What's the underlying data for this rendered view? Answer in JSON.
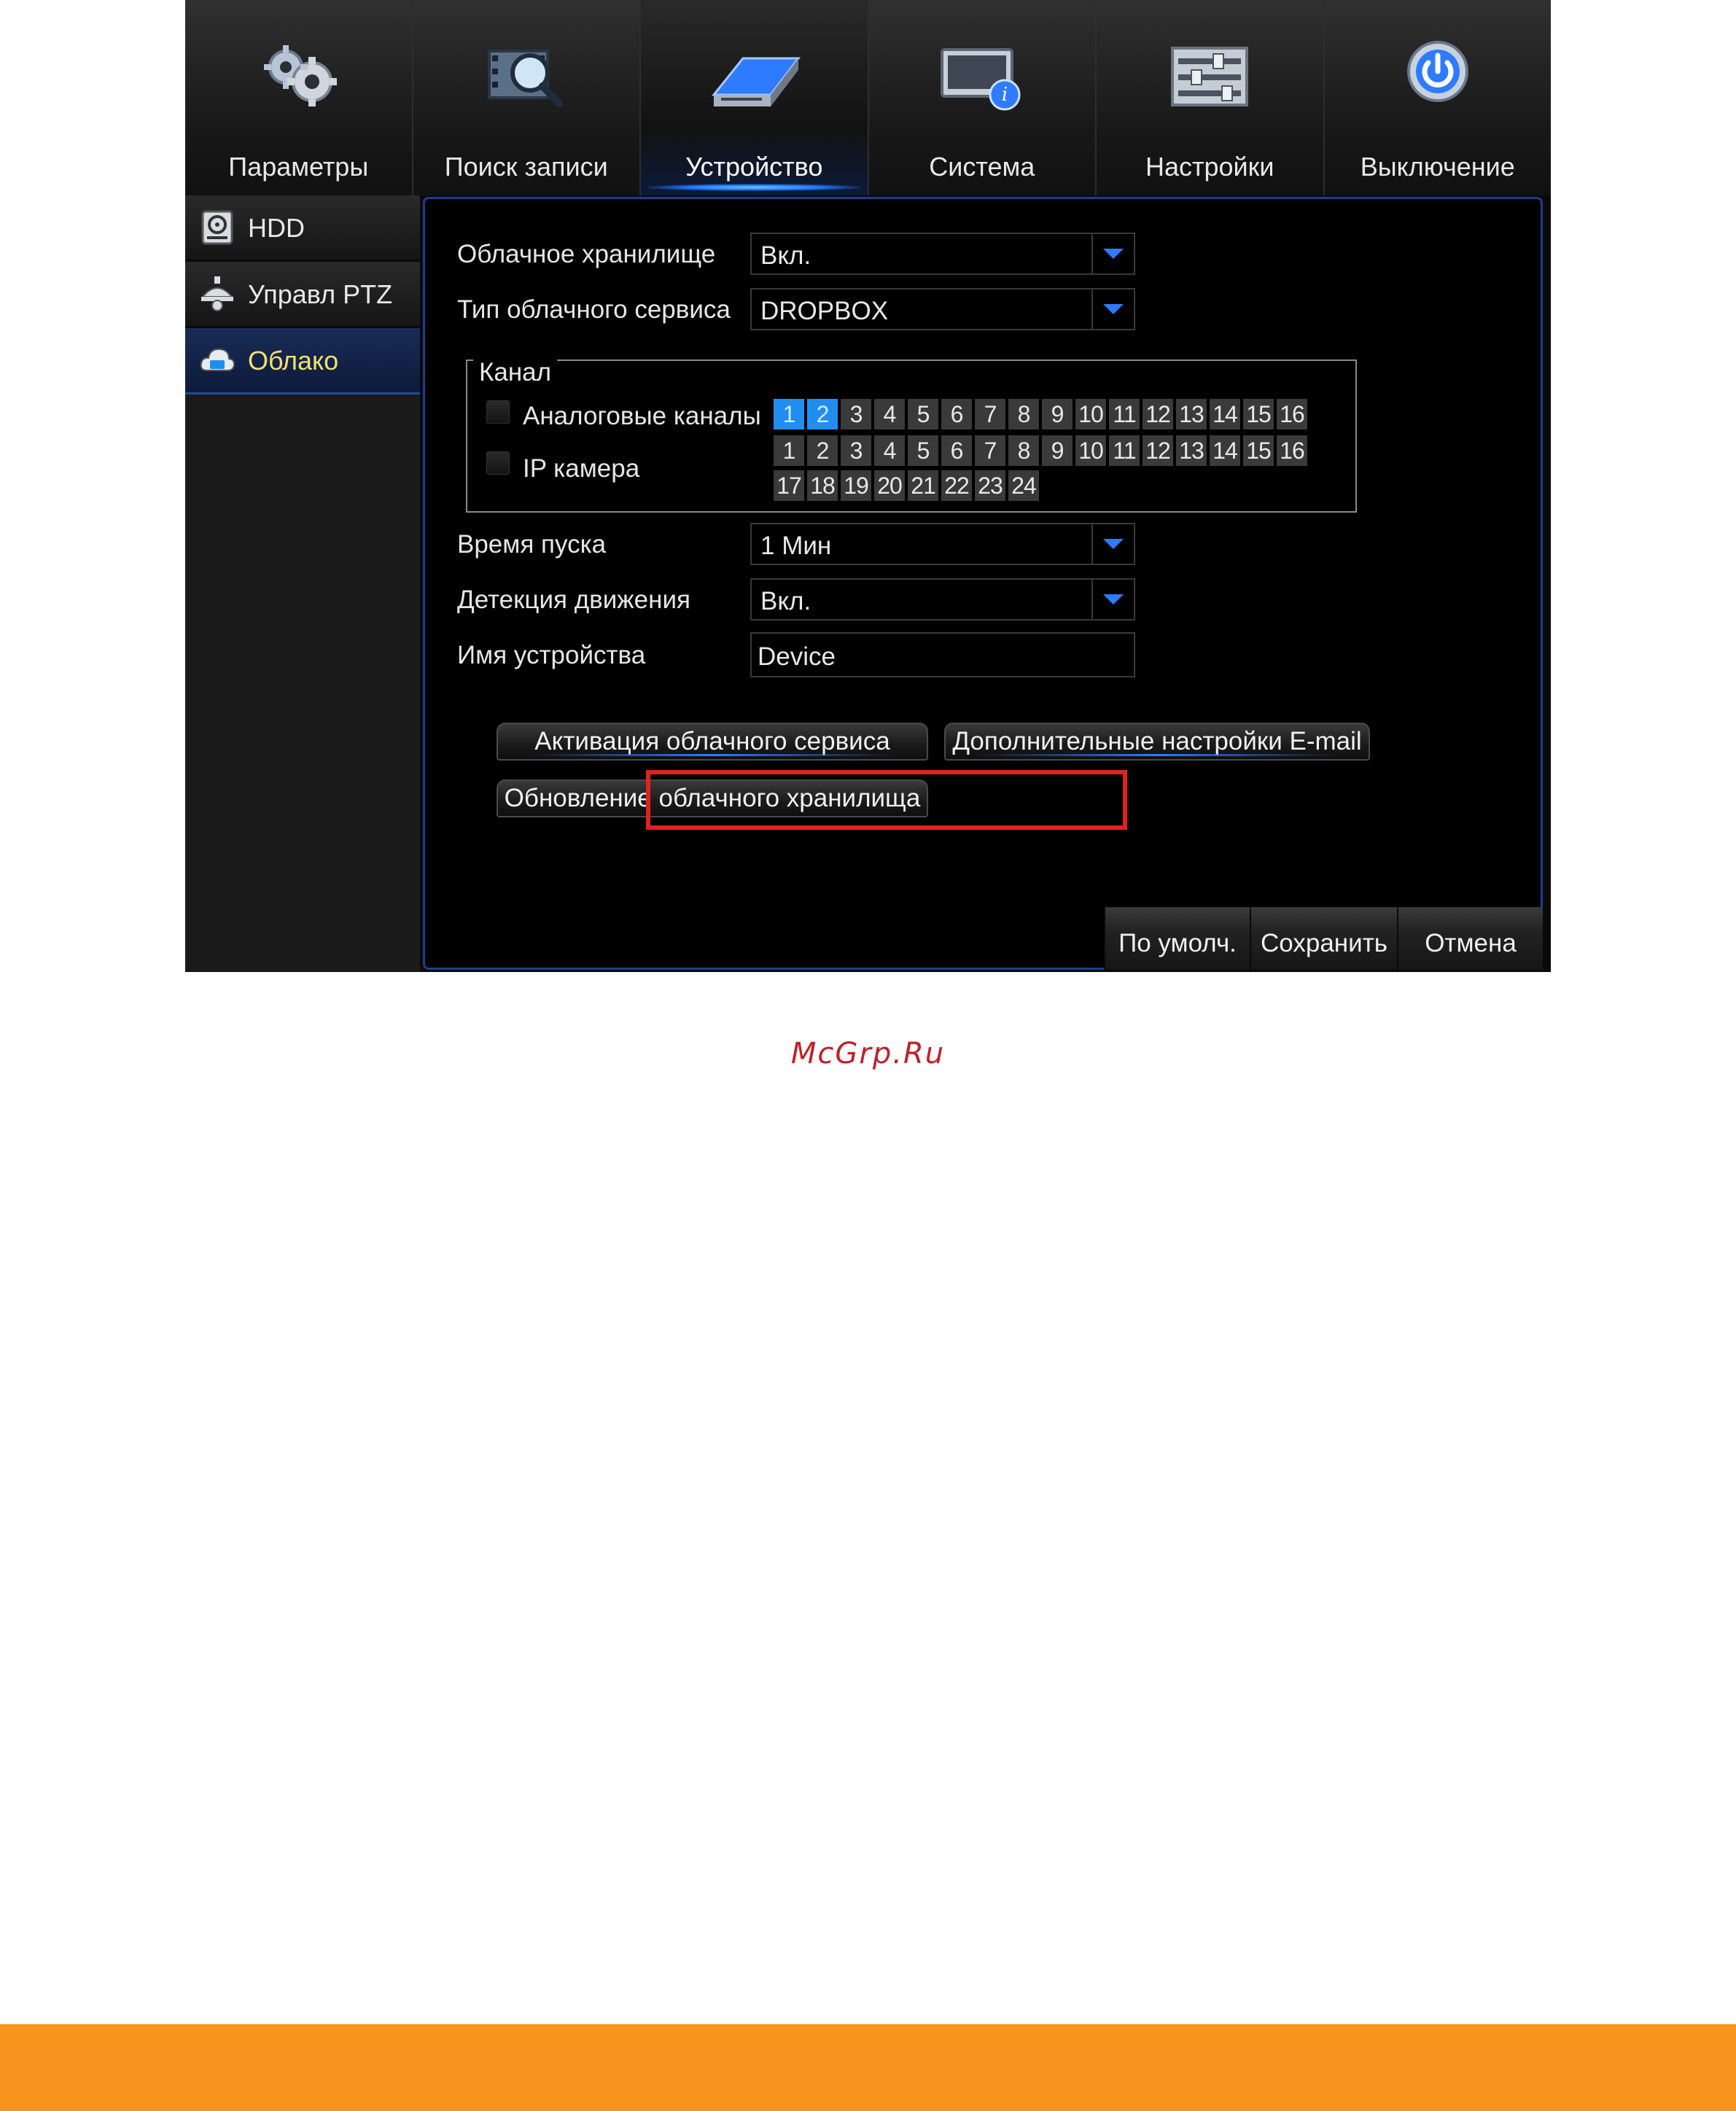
{
  "topnav": {
    "tabs": [
      {
        "label": "Параметры",
        "icon": "gears-icon"
      },
      {
        "label": "Поиск записи",
        "icon": "film-search-icon"
      },
      {
        "label": "Устройство",
        "icon": "hdd-device-icon",
        "active": true
      },
      {
        "label": "Система",
        "icon": "monitor-info-icon"
      },
      {
        "label": "Настройки",
        "icon": "sliders-icon"
      },
      {
        "label": "Выключение",
        "icon": "power-icon"
      }
    ]
  },
  "sidebar": {
    "items": [
      {
        "label": "HDD",
        "icon": "hdd-icon"
      },
      {
        "label": "Управл PTZ",
        "icon": "ptz-camera-icon"
      },
      {
        "label": "Облако",
        "icon": "cloud-icon",
        "active": true
      }
    ]
  },
  "form": {
    "cloud_storage": {
      "label": "Облачное хранилище",
      "value": "Вкл."
    },
    "cloud_service_type": {
      "label": "Тип облачного сервиса",
      "value": "DROPBOX"
    },
    "channel": {
      "legend": "Канал",
      "analog_label": "Аналоговые каналы",
      "analog_channels": [
        "1",
        "2",
        "3",
        "4",
        "5",
        "6",
        "7",
        "8",
        "9",
        "10",
        "11",
        "12",
        "13",
        "14",
        "15",
        "16"
      ],
      "analog_selected": [
        "1",
        "2"
      ],
      "ip_label": "IP камера",
      "ip_channels_row1": [
        "1",
        "2",
        "3",
        "4",
        "5",
        "6",
        "7",
        "8",
        "9",
        "10",
        "11",
        "12",
        "13",
        "14",
        "15",
        "16"
      ],
      "ip_channels_row2": [
        "17",
        "18",
        "19",
        "20",
        "21",
        "22",
        "23",
        "24"
      ]
    },
    "start_time": {
      "label": "Время пуска",
      "value": "1 Мин"
    },
    "motion_detection": {
      "label": "Детекция движения",
      "value": "Вкл."
    },
    "device_name": {
      "label": "Имя устройства",
      "value": "Device"
    }
  },
  "buttons": {
    "activate_cloud": "Активация облачного сервиса",
    "email_settings": "Дополнительные настройки E-mail",
    "update_cloud": "Обновление облачного хранилища"
  },
  "bottom_buttons": {
    "default": "По умолч.",
    "save": "Сохранить",
    "cancel": "Отмена"
  },
  "watermark": "McGrp.Ru",
  "colors": {
    "accent_blue": "#1f8ef0",
    "highlight_red": "#e02222",
    "active_label_yellow": "#f0e070",
    "footer_orange": "#f7941d"
  }
}
